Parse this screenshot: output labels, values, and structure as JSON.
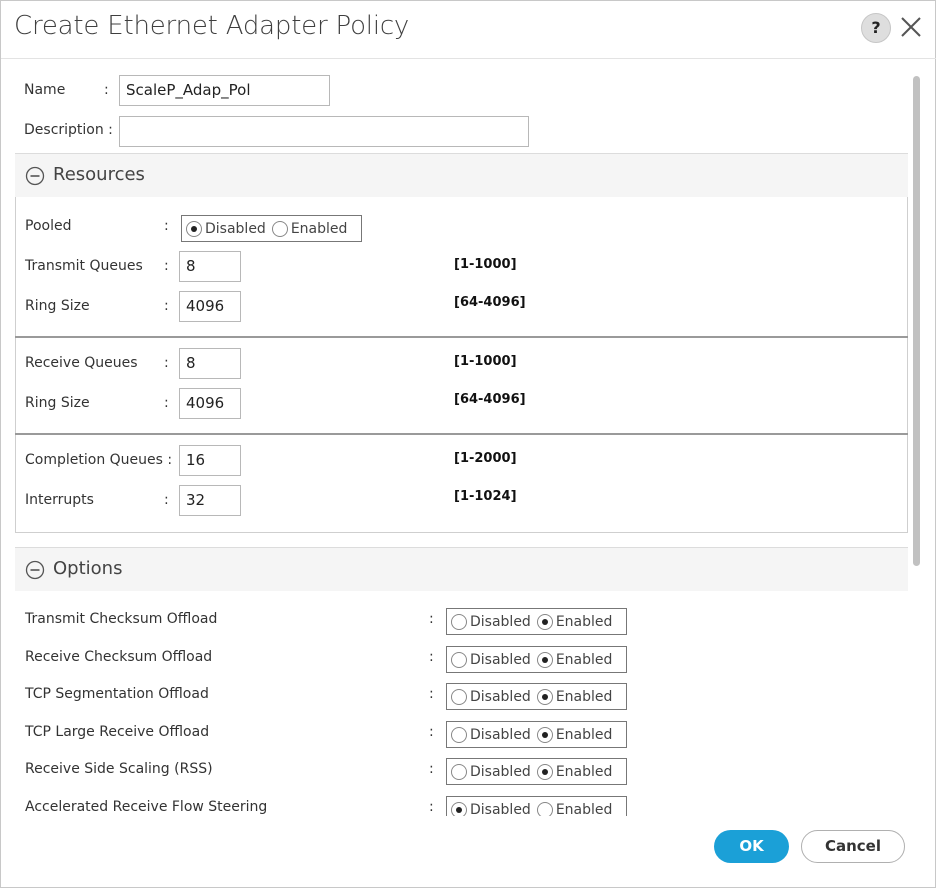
{
  "dialog": {
    "title": "Create Ethernet Adapter Policy",
    "help_label": "?"
  },
  "form": {
    "name_label": "Name",
    "name_value": "ScaleP_Adap_Pol",
    "description_label": "Description :",
    "description_value": ""
  },
  "resources": {
    "title": "Resources",
    "pooled_label": "Pooled",
    "pooled_options": [
      "Disabled",
      "Enabled"
    ],
    "pooled_selected": "Disabled",
    "transmit": [
      {
        "label": "Transmit Queues",
        "value": "8",
        "range": "[1-1000]"
      },
      {
        "label": "Ring Size",
        "value": "4096",
        "range": "[64-4096]"
      }
    ],
    "receive": [
      {
        "label": "Receive Queues",
        "value": "8",
        "range": "[1-1000]"
      },
      {
        "label": "Ring Size",
        "value": "4096",
        "range": "[64-4096]"
      }
    ],
    "completion": [
      {
        "label": "Completion Queues :",
        "value": "16",
        "range": "[1-2000]"
      },
      {
        "label": "Interrupts",
        "value": "32",
        "range": "[1-1024]"
      }
    ]
  },
  "options": {
    "title": "Options",
    "radio_labels": [
      "Disabled",
      "Enabled"
    ],
    "items": [
      {
        "label": "Transmit Checksum Offload",
        "selected": "Enabled"
      },
      {
        "label": "Receive Checksum Offload",
        "selected": "Enabled"
      },
      {
        "label": "TCP Segmentation Offload",
        "selected": "Enabled"
      },
      {
        "label": "TCP Large Receive Offload",
        "selected": "Enabled"
      },
      {
        "label": "Receive Side Scaling (RSS)",
        "selected": "Enabled"
      },
      {
        "label": "Accelerated Receive Flow Steering",
        "selected": "Disabled"
      }
    ]
  },
  "footer": {
    "ok_label": "OK",
    "cancel_label": "Cancel"
  },
  "colors": {
    "primary_button": "#1ba0d7",
    "section_header_bg": "#f5f5f5"
  }
}
